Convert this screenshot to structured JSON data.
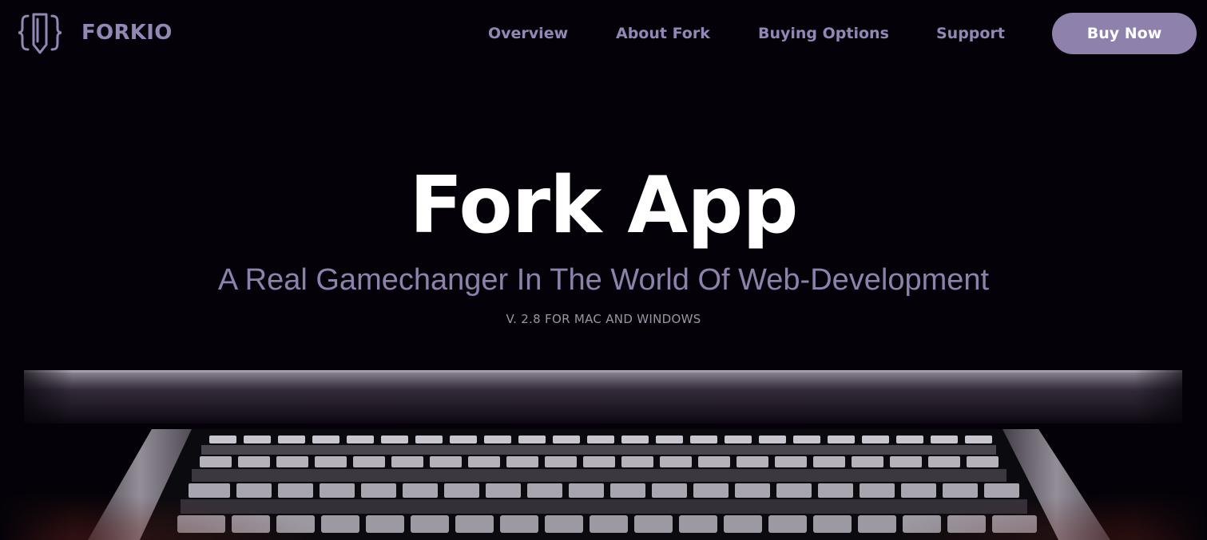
{
  "header": {
    "logo_icon": "pen-in-braces-icon",
    "logo_text": "FORKIO",
    "nav": [
      {
        "label": "Overview"
      },
      {
        "label": "About Fork"
      },
      {
        "label": "Buying Options"
      },
      {
        "label": "Support"
      }
    ],
    "cta_label": "Buy Now"
  },
  "hero": {
    "title": "Fork App",
    "subtitle": "A Real Gamechanger In The World Of Web-Development",
    "version": "V. 2.8 FOR MAC AND WINDOWS"
  },
  "colors": {
    "background": "#040208",
    "accent": "#8e82ac",
    "nav_text": "#9288b6",
    "title": "#ffffff",
    "version_text": "#9a96a4"
  }
}
